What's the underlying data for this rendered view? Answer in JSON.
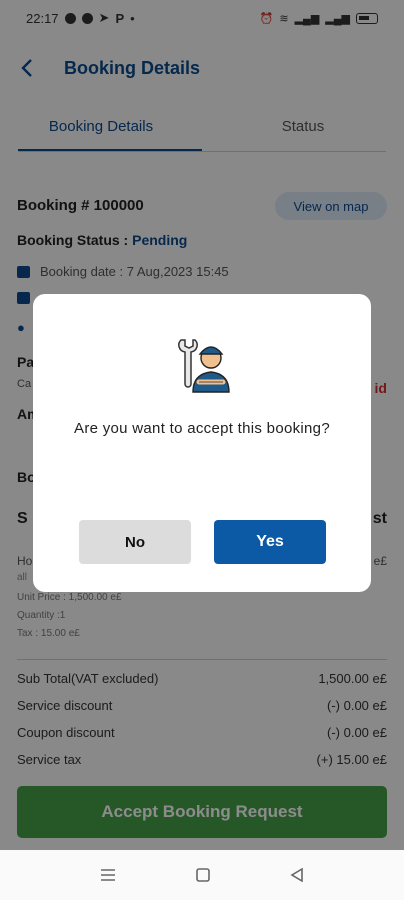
{
  "status_bar": {
    "time": "22:17",
    "dot": "•"
  },
  "app_bar": {
    "title": "Booking Details"
  },
  "tabs": [
    {
      "label": "Booking Details",
      "active": true
    },
    {
      "label": "Status",
      "active": false
    }
  ],
  "booking": {
    "id_label": "Booking # 100000",
    "map_button": "View on map",
    "status_label": "Booking Status :",
    "status_value": "Pending",
    "date_label": "Booking date : 7 Aug,2023 15:45",
    "payment_partial": "Pa",
    "payment_sub": "Ca",
    "amount_partial": "Am",
    "unpaid_partial": "id",
    "section_partial": "Bo",
    "service_partial": "S",
    "service_right_partial": "st"
  },
  "item": {
    "name_partial": "Ho",
    "price_partial": "e£",
    "sub_partial": "all",
    "unit_price": "Unit Price : 1,500.00 e£",
    "quantity": "Quantity :1",
    "tax": "Tax : 15.00 e£"
  },
  "summary": [
    {
      "label": "Sub Total(VAT excluded)",
      "value": "1,500.00 e£"
    },
    {
      "label": "Service discount",
      "value": "(-) 0.00 e£"
    },
    {
      "label": "Coupon discount",
      "value": "(-) 0.00 e£"
    },
    {
      "label": "Service tax",
      "value": "(+) 15.00 e£"
    }
  ],
  "accept_button": "Accept Booking Request",
  "dialog": {
    "message": "Are you want to accept this booking?",
    "no_label": "No",
    "yes_label": "Yes",
    "icon": "mechanic-worker-icon"
  },
  "colors": {
    "primary": "#0c4a8c",
    "accept": "#46a047",
    "unpaid": "#d32f2f",
    "yes": "#0c5aa6"
  }
}
